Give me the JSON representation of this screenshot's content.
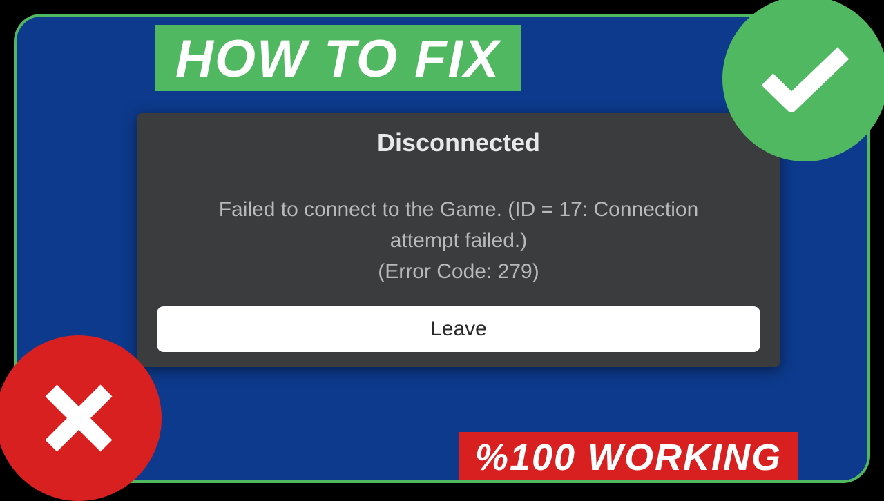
{
  "banners": {
    "title": "HOW TO FIX",
    "working": "%100 WORKING"
  },
  "dialog": {
    "title": "Disconnected",
    "message_line1": "Failed to connect to the Game. (ID = 17: Connection",
    "message_line2": "attempt failed.)",
    "message_line3": "(Error Code: 279)",
    "button_label": "Leave"
  },
  "colors": {
    "frame_bg": "#0d3a8c",
    "green": "#4fb860",
    "red": "#d92020",
    "dialog_bg": "#3a3c3d"
  }
}
